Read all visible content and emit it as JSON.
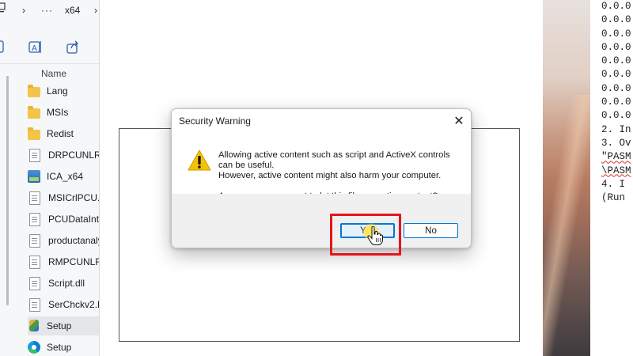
{
  "explorer": {
    "breadcrumb": {
      "more": "···",
      "folder": "x64"
    },
    "column_header": "Name",
    "files": [
      {
        "label": "Lang",
        "icon": "folder-icon"
      },
      {
        "label": "MSIs",
        "icon": "folder-icon"
      },
      {
        "label": "Redist",
        "icon": "folder-icon"
      },
      {
        "label": "DRPCUNLR.c",
        "icon": "document-icon"
      },
      {
        "label": "ICA_x64",
        "icon": "image-icon"
      },
      {
        "label": "MSICrlPCU.D",
        "icon": "document-icon"
      },
      {
        "label": "PCUDataIntl.",
        "icon": "document-icon"
      },
      {
        "label": "productanaly",
        "icon": "document-icon"
      },
      {
        "label": "RMPCUNLR.",
        "icon": "document-icon"
      },
      {
        "label": "Script.dll",
        "icon": "document-icon"
      },
      {
        "label": "SerChckv2.D",
        "icon": "document-icon"
      },
      {
        "label": "Setup",
        "icon": "setup-icon",
        "selected": true
      },
      {
        "label": "Setup",
        "icon": "edge-icon"
      }
    ]
  },
  "dialog": {
    "title": "Security Warning",
    "message_line1": "Allowing active content such as script and ActiveX controls can be useful.",
    "message_line2": "However, active content might also harm your computer.",
    "question": "Are you sure you want to let this file run active content?",
    "yes_label": "Yes",
    "no_label": "No",
    "close_glyph": "✕"
  },
  "text_pane": {
    "lines": [
      "0.0.0",
      "0.0.0",
      "0.0.0",
      "0.0.0",
      "0.0.0",
      "0.0.0",
      "0.0.0",
      "0.0.0",
      "0.0.0",
      "2. In",
      "3. Ov",
      "\"PASM",
      "\\PASM",
      "4. I",
      "(Run"
    ]
  },
  "colors": {
    "accent": "#0078d4",
    "highlight": "#e4151b",
    "warning": "#f5c400"
  }
}
